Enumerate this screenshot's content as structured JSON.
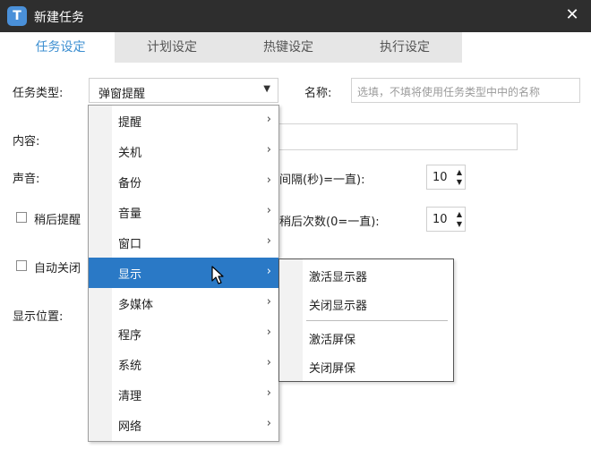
{
  "window": {
    "title": "新建任务",
    "logo_letter": "T",
    "close_glyph": "✕"
  },
  "tabs": [
    {
      "label": "任务设定",
      "active": true
    },
    {
      "label": "计划设定",
      "active": false
    },
    {
      "label": "热键设定",
      "active": false
    },
    {
      "label": "执行设定",
      "active": false
    }
  ],
  "form": {
    "task_type_label": "任务类型:",
    "task_type_value": "弹窗提醒",
    "name_label": "名称:",
    "name_placeholder": "选填，不填将使用任务类型中中的名称",
    "content_label": "内容:",
    "sound_label": "声音:",
    "interval_label": "间隔(秒)=一直):",
    "interval_value": "10",
    "snooze_checkbox_label": "稍后提醒",
    "snooze_count_label": "稍后次数(0=一直):",
    "snooze_count_value": "10",
    "autoclose_checkbox_label": "自动关闭",
    "display_position_label": "显示位置:"
  },
  "menu": {
    "items": [
      {
        "label": "提醒",
        "arrow": "›"
      },
      {
        "label": "关机",
        "arrow": "›"
      },
      {
        "label": "备份",
        "arrow": "›"
      },
      {
        "label": "音量",
        "arrow": "›"
      },
      {
        "label": "窗口",
        "arrow": "›"
      },
      {
        "label": "显示",
        "arrow": "›",
        "highlight": true
      },
      {
        "label": "多媒体",
        "arrow": "›"
      },
      {
        "label": "程序",
        "arrow": "›"
      },
      {
        "label": "系统",
        "arrow": "›"
      },
      {
        "label": "清理",
        "arrow": "›"
      },
      {
        "label": "网络",
        "arrow": "›"
      }
    ]
  },
  "submenu": {
    "items": [
      {
        "label": "激活显示器"
      },
      {
        "label": "关闭显示器"
      },
      {
        "label": "激活屏保"
      },
      {
        "label": "关闭屏保"
      }
    ]
  },
  "colors": {
    "accent": "#3d8fd1",
    "highlight": "#2a79c6",
    "titlebar": "#2e2e2e"
  }
}
